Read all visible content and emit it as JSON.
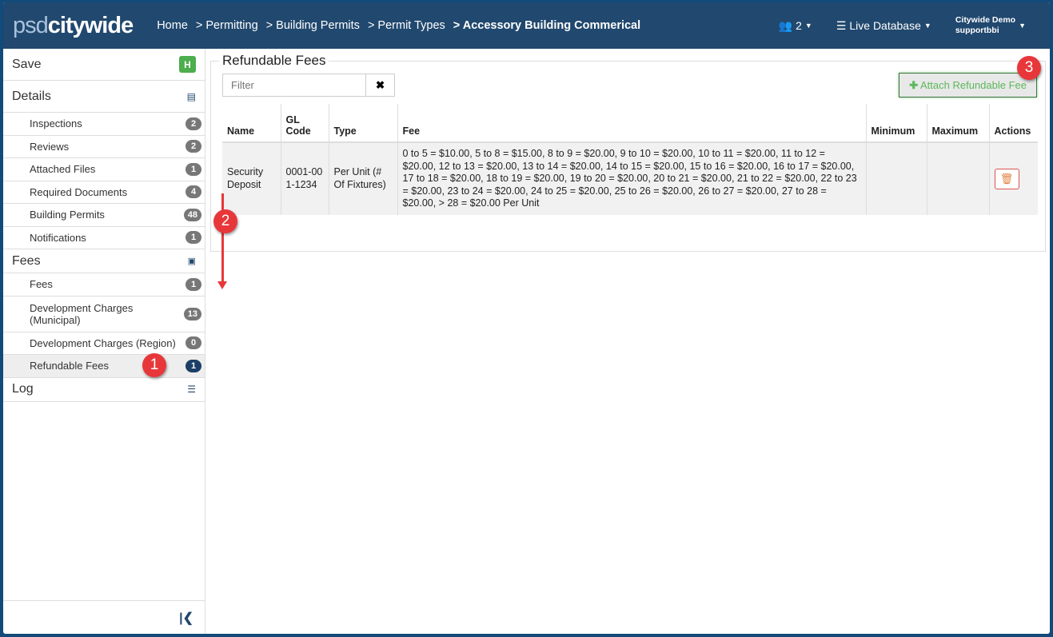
{
  "header": {
    "logo_light": "psd",
    "logo_bold": "citywide",
    "breadcrumbs": [
      "Home",
      "> Permitting",
      "> Building Permits",
      "> Permit Types"
    ],
    "current": "> Accessory Building Commerical",
    "users_count": "2",
    "database": "Live Database",
    "user_org": "Citywide Demo",
    "user_name": "supportbbi"
  },
  "sidebar": {
    "save": "Save",
    "details": "Details",
    "details_items": [
      {
        "label": "Inspections",
        "count": "2"
      },
      {
        "label": "Reviews",
        "count": "2"
      },
      {
        "label": "Attached Files",
        "count": "1"
      },
      {
        "label": "Required Documents",
        "count": "4"
      },
      {
        "label": "Building Permits",
        "count": "48"
      },
      {
        "label": "Notifications",
        "count": "1"
      }
    ],
    "fees": "Fees",
    "fees_items": [
      {
        "label": "Fees",
        "count": "1"
      },
      {
        "label": "Development Charges (Municipal)",
        "count": "13"
      },
      {
        "label": "Development Charges (Region)",
        "count": "0"
      },
      {
        "label": "Refundable Fees",
        "count": "1"
      }
    ],
    "log": "Log"
  },
  "main": {
    "title": "Refundable Fees",
    "filter_placeholder": "Filter",
    "attach": "Attach Refundable Fee",
    "columns": [
      "Name",
      "GL Code",
      "Type",
      "Fee",
      "Minimum",
      "Maximum",
      "Actions"
    ],
    "rows": [
      {
        "name": "Security Deposit",
        "gl": "0001-001-1234",
        "type": "Per Unit (# Of Fixtures)",
        "fee": "0 to 5 = $10.00, 5 to 8 = $15.00, 8 to 9 = $20.00, 9 to 10 = $20.00, 10 to 11 = $20.00, 11 to 12 = $20.00, 12 to 13 = $20.00, 13 to 14 = $20.00, 14 to 15 = $20.00, 15 to 16 = $20.00, 16 to 17 = $20.00, 17 to 18 = $20.00, 18 to 19 = $20.00, 19 to 20 = $20.00, 20 to 21 = $20.00, 21 to 22 = $20.00, 22 to 23 = $20.00, 23 to 24 = $20.00, 24 to 25 = $20.00, 25 to 26 = $20.00, 26 to 27 = $20.00, 27 to 28 = $20.00, > 28 = $20.00 Per Unit",
        "min": "",
        "max": ""
      }
    ]
  },
  "markers": [
    "1",
    "2",
    "3"
  ]
}
